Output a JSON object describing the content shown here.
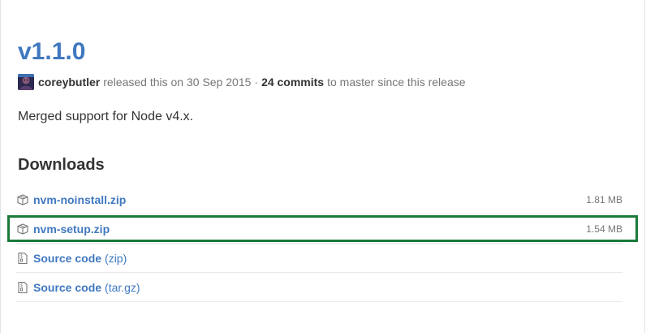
{
  "release": {
    "title": "v1.1.0",
    "author": "coreybutler",
    "released_text": "released this on 30 Sep 2015",
    "separator": "·",
    "commits_count": "24 commits",
    "commits_suffix": "to master since this release",
    "description": "Merged support for Node v4.x."
  },
  "downloads": {
    "heading": "Downloads",
    "assets": [
      {
        "name": "nvm-noinstall.zip",
        "size": "1.81 MB",
        "icon": "package-icon"
      },
      {
        "name": "nvm-setup.zip",
        "size": "1.54 MB",
        "icon": "package-icon",
        "highlighted": true
      }
    ],
    "source": [
      {
        "label": "Source code",
        "ext": "(zip)",
        "icon": "file-zip-icon"
      },
      {
        "label": "Source code",
        "ext": "(tar.gz)",
        "icon": "file-zip-icon"
      }
    ]
  },
  "colors": {
    "link": "#4078c0",
    "text": "#333333",
    "muted": "#767676",
    "highlight": "#1a7a3a"
  }
}
